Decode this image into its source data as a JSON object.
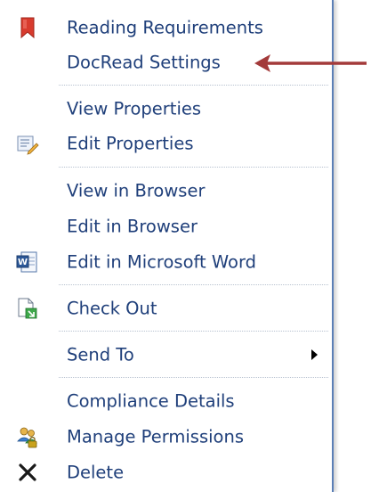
{
  "menu": {
    "items": [
      {
        "label": "Reading Requirements",
        "icon": "bookmark-icon"
      },
      {
        "label": "DocRead Settings",
        "icon": ""
      },
      {
        "label": "View Properties",
        "icon": ""
      },
      {
        "label": "Edit Properties",
        "icon": "edit-properties-icon"
      },
      {
        "label": "View in Browser",
        "icon": ""
      },
      {
        "label": "Edit in Browser",
        "icon": ""
      },
      {
        "label": "Edit in Microsoft Word",
        "icon": "word-document-icon"
      },
      {
        "label": "Check Out",
        "icon": "check-out-icon"
      },
      {
        "label": "Send To",
        "icon": "",
        "submenu": true
      },
      {
        "label": "Compliance Details",
        "icon": ""
      },
      {
        "label": "Manage Permissions",
        "icon": "manage-permissions-icon"
      },
      {
        "label": "Delete",
        "icon": "delete-icon"
      }
    ]
  },
  "colors": {
    "item_text": "#1f3f7a",
    "arrow_annotation": "#a33a3a",
    "menu_border": "#5b7fb6"
  }
}
